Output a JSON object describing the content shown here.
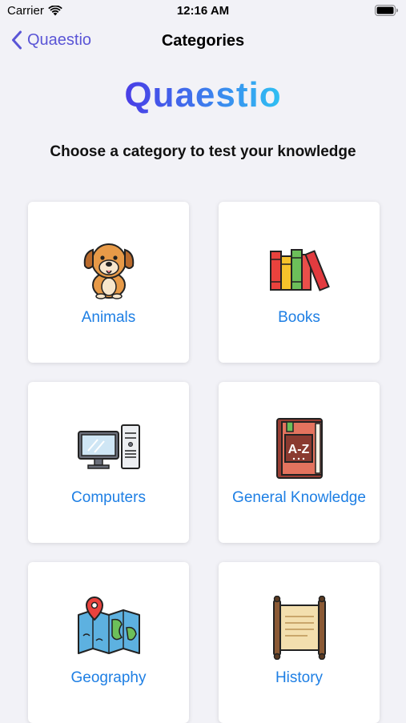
{
  "status_bar": {
    "carrier": "Carrier",
    "time": "12:16 AM"
  },
  "nav": {
    "back_label": "Quaestio",
    "title": "Categories"
  },
  "logo": {
    "text": "Quaestio"
  },
  "subtitle": "Choose a category to test your knowledge",
  "categories": [
    {
      "label": "Animals",
      "icon": "dog-icon"
    },
    {
      "label": "Books",
      "icon": "books-icon"
    },
    {
      "label": "Computers",
      "icon": "computer-icon"
    },
    {
      "label": "General Knowledge",
      "icon": "a-z-book-icon"
    },
    {
      "label": "Geography",
      "icon": "map-icon"
    },
    {
      "label": "History",
      "icon": "scroll-icon"
    }
  ],
  "colors": {
    "accent": "#5a55d6",
    "label": "#1e7fe4",
    "background": "#f2f2f7"
  }
}
